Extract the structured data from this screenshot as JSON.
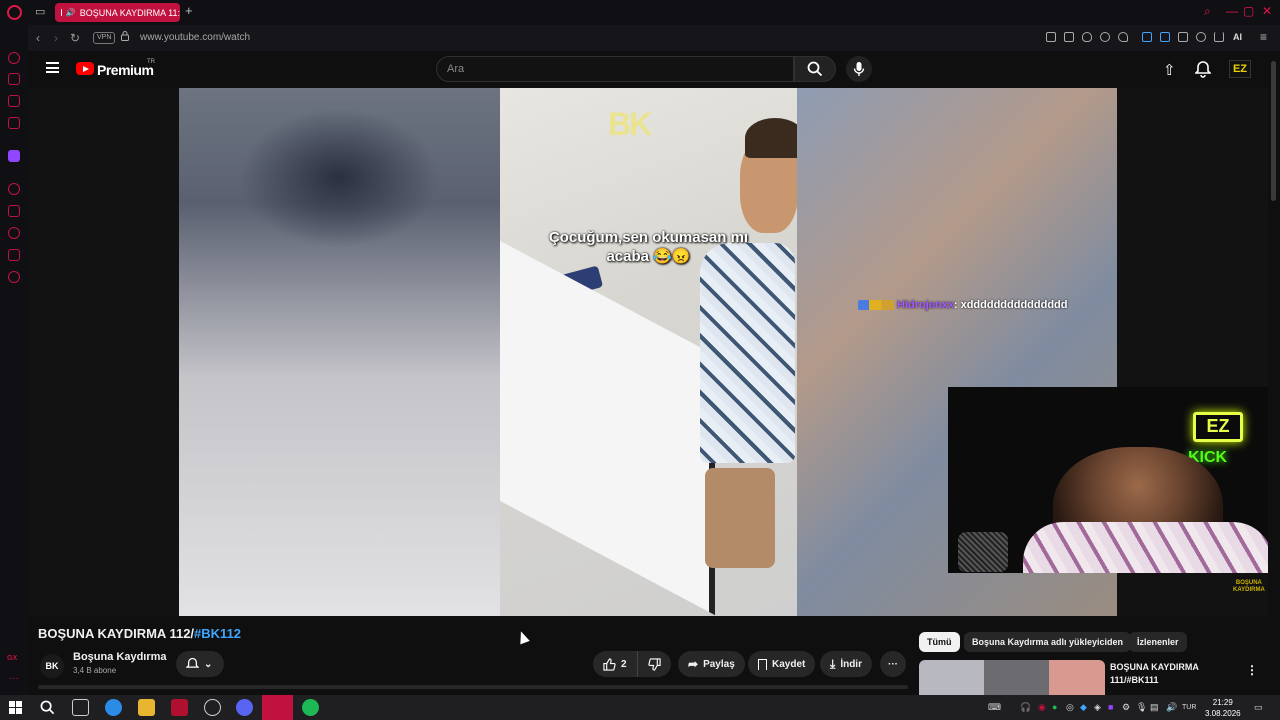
{
  "browser": {
    "tab_title": "BOŞUNA KAYDIRMA 11:",
    "url": "www.youtube.com/watch",
    "vpn_label": "VPN",
    "ai_label": "AI"
  },
  "sidebar": {
    "gx_label": "GX",
    "more_label": "···"
  },
  "youtube": {
    "brand": "Premium",
    "region": "TR",
    "search_placeholder": "Ara",
    "avatar_label": "EZ"
  },
  "video": {
    "watermark": "BK",
    "caption_line1": "Çocuğum,sen okumasan mı",
    "caption_line2": "acaba 😂😠",
    "chat_user": "Hidrojenxx",
    "chat_message": ": xddddddddddddddd",
    "cam_neon": "EZ",
    "cam_kick": "KICK",
    "corner_watermark_1": "BOŞUNA",
    "corner_watermark_2": "KAYDIRMA"
  },
  "watch": {
    "title_main": "BOŞUNA KAYDIRMA 112/",
    "title_tag": "#BK112",
    "channel_avatar": "BK",
    "channel_name": "Boşuna Kaydırma",
    "subscribers": "3,4 B abone",
    "like_count": "2",
    "share_label": "Paylaş",
    "save_label": "Kaydet",
    "download_label": "İndir",
    "more_label": "···"
  },
  "related": {
    "chips": [
      "Tümü",
      "Boşuna Kaydırma adlı yükleyiciden",
      "İzlenenler"
    ],
    "item_title": "BOŞUNA KAYDIRMA 111/#BK111"
  },
  "taskbar": {
    "language": "TUR",
    "time": "21:29",
    "date": "3.08.2026"
  },
  "colors": {
    "accent": "#c1123f",
    "youtube_red": "#ff0000",
    "link": "#3ea6ff",
    "chat_user": "#a259ff"
  }
}
